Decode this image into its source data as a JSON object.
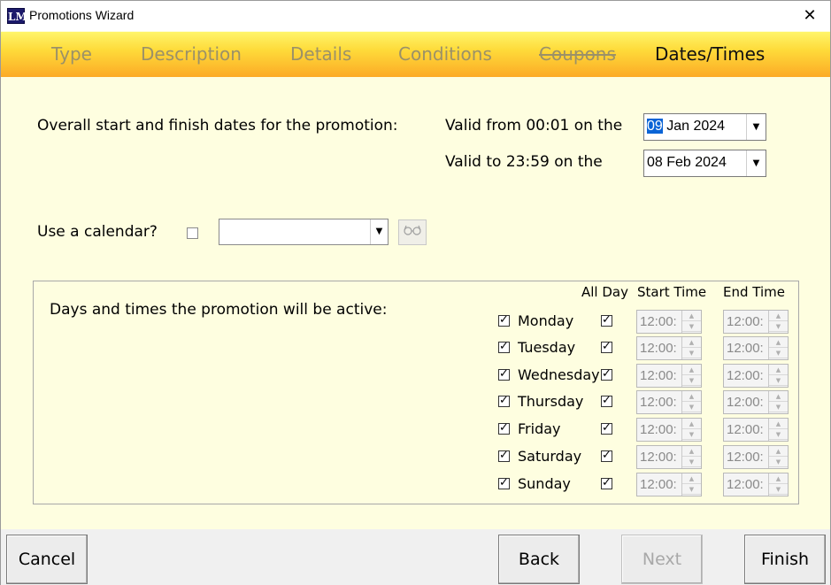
{
  "window": {
    "title": "Promotions Wizard",
    "app_icon_text": "LM",
    "close_glyph": "✕"
  },
  "tabs": [
    {
      "label": "Type",
      "state": "inactive"
    },
    {
      "label": "Description",
      "state": "inactive"
    },
    {
      "label": "Details",
      "state": "inactive"
    },
    {
      "label": "Conditions",
      "state": "inactive"
    },
    {
      "label": "Coupons",
      "state": "disabled-strikethrough"
    },
    {
      "label": "Dates/Times",
      "state": "active"
    }
  ],
  "dates": {
    "overall_label": "Overall start and finish dates for the promotion:",
    "valid_from_label": "Valid from 00:01 on the",
    "valid_from_day_selected": "09",
    "valid_from_rest": " Jan 2024",
    "valid_to_label": "Valid to 23:59 on the",
    "valid_to_value": "08 Feb 2024"
  },
  "calendar": {
    "label": "Use a calendar?",
    "checked": false,
    "selected_value": "",
    "lookup_icon": "glasses-icon"
  },
  "schedule": {
    "label": "Days and times the promotion will be active:",
    "headers": {
      "all_day": "All Day",
      "start_time": "Start Time",
      "end_time": "End Time"
    },
    "days": [
      {
        "name": "Monday",
        "active": true,
        "all_day": true,
        "start": "12:00:",
        "end": "12:00:"
      },
      {
        "name": "Tuesday",
        "active": true,
        "all_day": true,
        "start": "12:00:",
        "end": "12:00:"
      },
      {
        "name": "Wednesday",
        "active": true,
        "all_day": true,
        "start": "12:00:",
        "end": "12:00:"
      },
      {
        "name": "Thursday",
        "active": true,
        "all_day": true,
        "start": "12:00:",
        "end": "12:00:"
      },
      {
        "name": "Friday",
        "active": true,
        "all_day": true,
        "start": "12:00:",
        "end": "12:00:"
      },
      {
        "name": "Saturday",
        "active": true,
        "all_day": true,
        "start": "12:00:",
        "end": "12:00:"
      },
      {
        "name": "Sunday",
        "active": true,
        "all_day": true,
        "start": "12:00:",
        "end": "12:00:"
      }
    ]
  },
  "buttons": {
    "cancel": "Cancel",
    "back": "Back",
    "next": "Next",
    "finish": "Finish"
  },
  "colors": {
    "tab_gradient_top": "#fff56a",
    "tab_gradient_bottom": "#fcaa26",
    "background": "#fefee0",
    "selection": "#0a64d6"
  }
}
